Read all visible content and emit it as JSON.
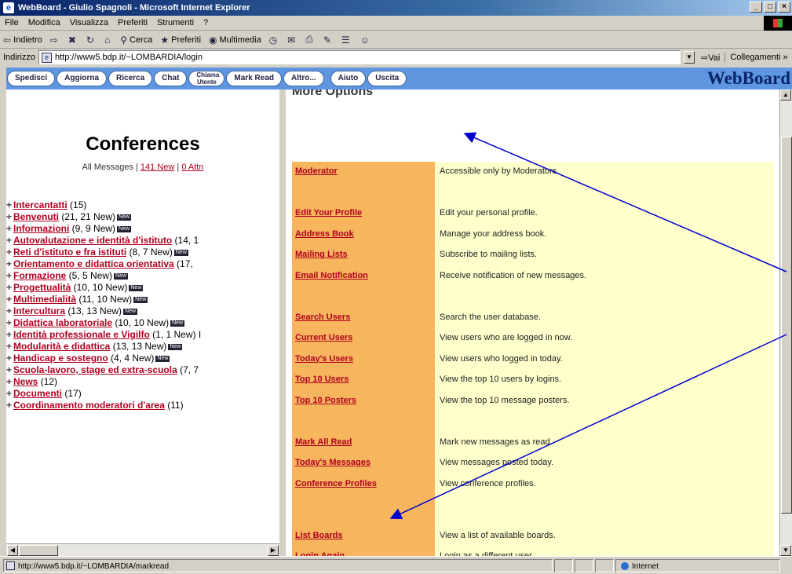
{
  "window": {
    "title": "WebBoard - Giulio Spagnoli - Microsoft Internet Explorer",
    "buttons": [
      "_",
      "□",
      "×"
    ]
  },
  "menubar": [
    "File",
    "Modifica",
    "Visualizza",
    "Preferiti",
    "Strumenti",
    "?"
  ],
  "toolbar": [
    {
      "label": "Indietro",
      "icon": "back-arrow-icon",
      "glyph": "⇦"
    },
    {
      "label": "",
      "icon": "forward-arrow-icon",
      "glyph": "⇨"
    },
    {
      "label": "",
      "icon": "stop-icon",
      "glyph": "✖"
    },
    {
      "label": "",
      "icon": "refresh-icon",
      "glyph": "↻"
    },
    {
      "label": "",
      "icon": "home-icon",
      "glyph": "⌂"
    },
    {
      "label": "Cerca",
      "icon": "search-icon",
      "glyph": "⚲"
    },
    {
      "label": "Preferiti",
      "icon": "favorites-icon",
      "glyph": "★"
    },
    {
      "label": "Multimedia",
      "icon": "media-icon",
      "glyph": "◉"
    },
    {
      "label": "",
      "icon": "history-icon",
      "glyph": "◷"
    },
    {
      "label": "",
      "icon": "mail-icon",
      "glyph": "✉"
    },
    {
      "label": "",
      "icon": "print-icon",
      "glyph": "⎙"
    },
    {
      "label": "",
      "icon": "edit-icon",
      "glyph": "✎"
    },
    {
      "label": "",
      "icon": "discuss-icon",
      "glyph": "☰"
    },
    {
      "label": "",
      "icon": "messenger-icon",
      "glyph": "☺"
    }
  ],
  "addressbar": {
    "label": "Indirizzo",
    "url": "http://www5.bdp.it/~LOMBARDIA/login",
    "go": "Vai",
    "links": "Collegamenti »"
  },
  "webboard_nav": {
    "buttons": [
      "Spedisci",
      "Aggiorna",
      "Ricerca",
      "Chat",
      "Mark Read",
      "Altro...",
      "Aiuto",
      "Uscita"
    ],
    "small_button": "Chiama Utente",
    "brand": "WebBoard"
  },
  "conferences": {
    "title": "Conferences",
    "sub_prefix": "All Messages | ",
    "sub_new": "141 New",
    "sub_sep": " | ",
    "sub_attn": "0 Attn",
    "new_badge": "New",
    "items": [
      {
        "name": "Intercantatti",
        "count": " (15)",
        "new": false
      },
      {
        "name": "Benvenuti",
        "count": " (21, 21 New)",
        "new": true
      },
      {
        "name": "Informazioni",
        "count": " (9, 9 New)",
        "new": true
      },
      {
        "name": "Autovalutazione e identità d'istituto",
        "count": " (14, 1",
        "new": false
      },
      {
        "name": "Reti d'istituto e fra istituti",
        "count": " (8, 7 New)",
        "new": true
      },
      {
        "name": "Orientamento e didattica orientativa",
        "count": " (17,",
        "new": false
      },
      {
        "name": "Formazione",
        "count": " (5, 5 New)",
        "new": true
      },
      {
        "name": "Progettualità",
        "count": " (10, 10 New)",
        "new": true
      },
      {
        "name": "Multimedialità",
        "count": " (11, 10 New)",
        "new": true
      },
      {
        "name": "Intercultura",
        "count": " (13, 13 New)",
        "new": true
      },
      {
        "name": "Didattica laboratoriale",
        "count": " (10, 10 New)",
        "new": true
      },
      {
        "name": "Identità professionale e Vigilfo",
        "count": " (1, 1 New) I",
        "new": false
      },
      {
        "name": "Modularità e didattica",
        "count": " (13, 13 New)",
        "new": true
      },
      {
        "name": "Handicap e sostegno",
        "count": " (4, 4 New)",
        "new": true
      },
      {
        "name": "Scuola-lavoro, stage ed extra-scuola",
        "count": " (7, 7",
        "new": false
      },
      {
        "name": "News",
        "count": " (12)",
        "new": false
      },
      {
        "name": "Documenti",
        "count": " (17)",
        "new": false
      },
      {
        "name": "Coordinamento moderatori d'area",
        "count": " (11)",
        "new": false
      }
    ]
  },
  "more_options": {
    "title": "More Options",
    "rows": [
      {
        "link": "Moderator",
        "desc": "Accessible only by Moderators.",
        "slot": 0
      },
      {
        "link": "Edit Your Profile",
        "desc": "Edit your personal profile.",
        "slot": 2
      },
      {
        "link": "Address Book",
        "desc": "Manage your address book.",
        "slot": 3
      },
      {
        "link": "Mailing Lists",
        "desc": "Subscribe to mailing lists.",
        "slot": 4
      },
      {
        "link": "Email Notification",
        "desc": "Receive notification of new messages.",
        "slot": 5
      },
      {
        "link": "Search Users",
        "desc": "Search the user database.",
        "slot": 7
      },
      {
        "link": "Current Users",
        "desc": "View users who are logged in now.",
        "slot": 8
      },
      {
        "link": "Today's Users",
        "desc": "View users who logged in today.",
        "slot": 9
      },
      {
        "link": "Top 10 Users",
        "desc": "View the top 10 users by logins.",
        "slot": 10
      },
      {
        "link": "Top 10 Posters",
        "desc": "View the top 10 message posters.",
        "slot": 11
      },
      {
        "link": "Mark All Read",
        "desc": "Mark new messages as read.",
        "slot": 13
      },
      {
        "link": "Today's Messages",
        "desc": "View messages posted today.",
        "slot": 14
      },
      {
        "link": "Conference Profiles",
        "desc": "View conference profiles.",
        "slot": 15
      },
      {
        "link": "List Boards",
        "desc": "View a list of available boards.",
        "slot": 17.5
      },
      {
        "link": "Login Again",
        "desc": "Login as a different user.",
        "slot": 18.5
      }
    ]
  },
  "statusbar": {
    "text": "http://www5.bdp.it/~LOMBARDIA/markread",
    "zone": "Internet"
  },
  "colors": {
    "link": "#b00020",
    "nav_bar": "#5e97e0",
    "options_left": "#f7b55e",
    "options_right": "#ffffcc",
    "arrow": "#0000cc"
  }
}
